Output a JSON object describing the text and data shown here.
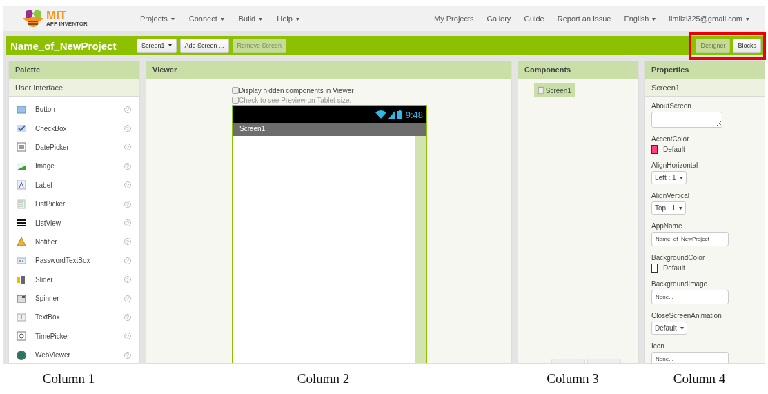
{
  "header": {
    "logo_title": "MIT",
    "logo_subtitle": "APP INVENTOR",
    "menus": [
      {
        "label": "Projects",
        "dropdown": true
      },
      {
        "label": "Connect",
        "dropdown": true
      },
      {
        "label": "Build",
        "dropdown": true
      },
      {
        "label": "Help",
        "dropdown": true
      }
    ],
    "links": [
      {
        "label": "My Projects",
        "dropdown": false
      },
      {
        "label": "Gallery",
        "dropdown": false
      },
      {
        "label": "Guide",
        "dropdown": false
      },
      {
        "label": "Report an Issue",
        "dropdown": false
      },
      {
        "label": "English",
        "dropdown": true
      },
      {
        "label": "limlizi325@gmail.com",
        "dropdown": true
      }
    ]
  },
  "project_bar": {
    "title": "Name_of_NewProject",
    "screen_select": "Screen1",
    "buttons": [
      {
        "label": "Add Screen ...",
        "disabled": false
      },
      {
        "label": "Remove Screen",
        "disabled": true
      }
    ],
    "view_buttons": [
      {
        "label": "Designer",
        "selected": true
      },
      {
        "label": "Blocks",
        "selected": false
      }
    ],
    "highlighted": true
  },
  "palette": {
    "title": "Palette",
    "category": "User Interface",
    "items": [
      {
        "label": "Button",
        "help": "?"
      },
      {
        "label": "CheckBox",
        "help": "?"
      },
      {
        "label": "DatePicker",
        "help": "?"
      },
      {
        "label": "Image",
        "help": "?"
      },
      {
        "label": "Label",
        "help": "?"
      },
      {
        "label": "ListPicker",
        "help": "?"
      },
      {
        "label": "ListView",
        "help": "?"
      },
      {
        "label": "Notifier",
        "help": "?"
      },
      {
        "label": "PasswordTextBox",
        "help": "?"
      },
      {
        "label": "Slider",
        "help": "?"
      },
      {
        "label": "Spinner",
        "help": "?"
      },
      {
        "label": "TextBox",
        "help": "?"
      },
      {
        "label": "TimePicker",
        "help": "?"
      },
      {
        "label": "WebViewer",
        "help": "?"
      }
    ]
  },
  "viewer": {
    "title": "Viewer",
    "options": [
      {
        "label": "Display hidden components in Viewer",
        "checked": false,
        "disabled": false
      },
      {
        "label": "Check to see Preview on Tablet size.",
        "checked": false,
        "disabled": true
      }
    ],
    "phone": {
      "time": "9:48",
      "screen_title": "Screen1"
    }
  },
  "components": {
    "title": "Components",
    "tree": [
      {
        "label": "Screen1",
        "selected": true
      }
    ]
  },
  "properties": {
    "title": "Properties",
    "component": "Screen1",
    "items": [
      {
        "kind": "textarea",
        "name": "AboutScreen"
      },
      {
        "kind": "color",
        "name": "AccentColor",
        "value": "Default",
        "color": "#ff4081"
      },
      {
        "kind": "select",
        "name": "AlignHorizontal",
        "value": "Left : 1"
      },
      {
        "kind": "select",
        "name": "AlignVertical",
        "value": "Top : 1"
      },
      {
        "kind": "text",
        "name": "AppName",
        "value": "Name_of_NewProject"
      },
      {
        "kind": "color",
        "name": "BackgroundColor",
        "value": "Default",
        "color": "#ffffff"
      },
      {
        "kind": "text",
        "name": "BackgroundImage",
        "value": "None..."
      },
      {
        "kind": "select",
        "name": "CloseScreenAnimation",
        "value": "Default"
      },
      {
        "kind": "text",
        "name": "Icon",
        "value": "None..."
      }
    ]
  },
  "captions": [
    "Column 1",
    "Column 2",
    "Column 3",
    "Column 4"
  ]
}
